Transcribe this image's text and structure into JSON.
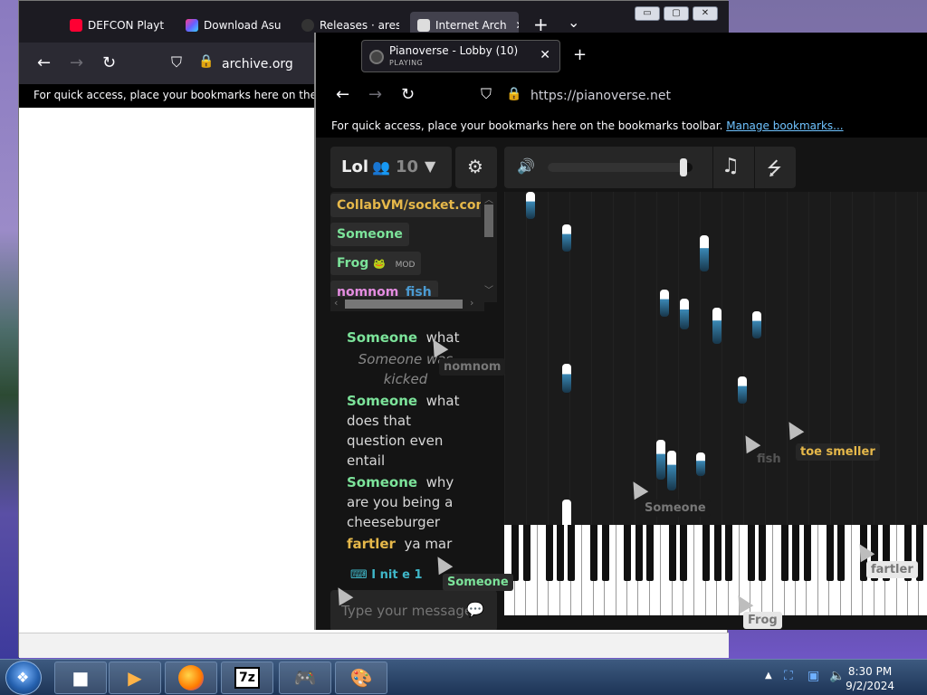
{
  "back_window": {
    "tabs": [
      {
        "label": "DEFCON Playth",
        "color": "#ff0033"
      },
      {
        "label": "Download Asuk",
        "color": "#8a5cff"
      },
      {
        "label": "Releases · ares-",
        "color": "#888888"
      },
      {
        "label": "Internet Arch",
        "color": "#dddddd"
      }
    ],
    "new_tab": "+",
    "tab_list": "⌄",
    "url": "archive.org",
    "bookmarks_text": "For quick access, place your bookmarks here on the bookm",
    "win_min": "▭",
    "win_max": "▢",
    "win_close": "✕"
  },
  "front_window": {
    "tab_title": "Pianoverse - Lobby (10)",
    "tab_status": "PLAYING",
    "tab_close": "✕",
    "new_tab": "+",
    "url": "https://pianoverse.net",
    "bookmarks_text": "For quick access, place your bookmarks here on the bookmarks toolbar.",
    "bookmarks_link": "Manage bookmarks..."
  },
  "room": {
    "name": "Lol",
    "user_count": "10"
  },
  "users": [
    {
      "name": "CollabVM/socket.com...",
      "color": "#e6b84a"
    },
    {
      "name": "Someone",
      "color": "#7ce39a"
    },
    {
      "name": "Frog",
      "color": "#7ce39a",
      "badge": "MOD"
    },
    {
      "name": "nomnom",
      "color": "#e48ce0"
    },
    {
      "name": "fish",
      "color": "#4b9ad1"
    }
  ],
  "chat": [
    {
      "user": "Someone",
      "text": "what",
      "color": "#7ce39a"
    },
    {
      "system": "Someone was kicked"
    },
    {
      "user": "Someone",
      "text": "what does that question even entail",
      "color": "#7ce39a"
    },
    {
      "user": "Someone",
      "text": "why are you being a cheeseburger",
      "color": "#7ce39a"
    },
    {
      "user": "fartler",
      "text": "ya mar",
      "color": "#e6b84a"
    }
  ],
  "typing": "I nit e 1",
  "chat_placeholder": "Type your message",
  "cursors": [
    {
      "label": "nomnom",
      "color": "#888888"
    },
    {
      "label": "toe smeller",
      "color": "#e6b84a"
    },
    {
      "label": "fish",
      "color": "#555555"
    },
    {
      "label": "Someone",
      "color": "#777777"
    },
    {
      "label": "fartler",
      "color": "#777777"
    },
    {
      "label": "Frog",
      "color": "#777777"
    },
    {
      "label": "Someone",
      "color": "#7ce39a"
    }
  ],
  "volume": 0.95,
  "clock": {
    "time": "8:30 PM",
    "date": "9/2/2024"
  }
}
